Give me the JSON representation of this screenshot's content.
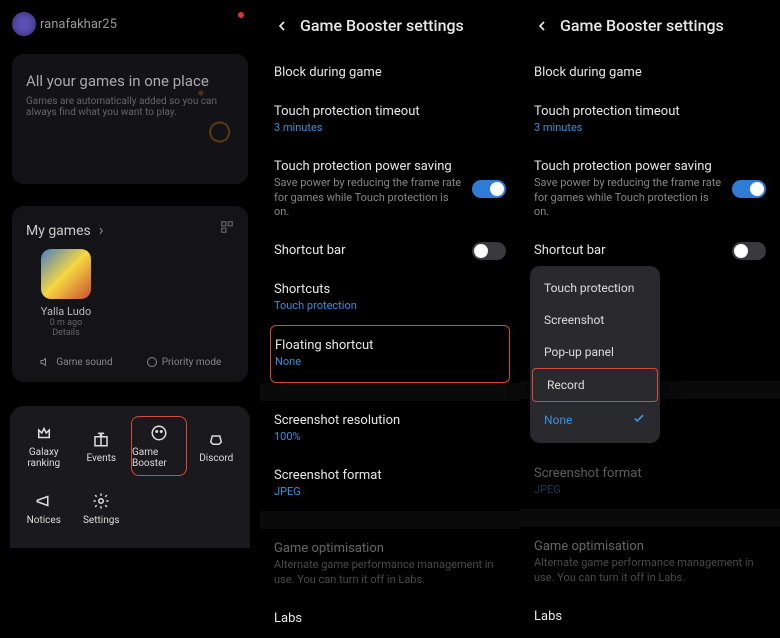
{
  "panel1": {
    "username": "ranafakhar25",
    "hero_title": "All your games in one place",
    "hero_sub": "Games are automatically added so you can always find what you want to play.",
    "my_games_label": "My games",
    "game": {
      "name": "Yalla Ludo",
      "meta1": "0 m ago",
      "meta2": "Details"
    },
    "quick": {
      "sound": "Game sound",
      "priority": "Priority mode"
    },
    "sheet": {
      "galaxy": "Galaxy ranking",
      "events": "Events",
      "booster": "Game Booster",
      "discord": "Discord",
      "notices": "Notices",
      "settings": "Settings"
    }
  },
  "panel2": {
    "title": "Game Booster settings",
    "block": "Block during game",
    "touch_timeout": {
      "title": "Touch protection timeout",
      "sub": "3 minutes"
    },
    "power_saving": {
      "title": "Touch protection power saving",
      "sub": "Save power by reducing the frame rate for games while Touch protection is on."
    },
    "shortcut_bar": "Shortcut bar",
    "shortcuts": {
      "title": "Shortcuts",
      "sub": "Touch protection"
    },
    "floating": {
      "title": "Floating shortcut",
      "sub": "None"
    },
    "ss_res": {
      "title": "Screenshot resolution",
      "sub": "100%"
    },
    "ss_fmt": {
      "title": "Screenshot format",
      "sub": "JPEG"
    },
    "game_opt": {
      "title": "Game optimisation",
      "sub": "Alternate game performance management in use. You can turn it off in Labs."
    },
    "labs": "Labs"
  },
  "panel3": {
    "title": "Game Booster settings",
    "popup": {
      "touch": "Touch protection",
      "screenshot": "Screenshot",
      "popup_panel": "Pop-up panel",
      "record": "Record",
      "none": "None"
    }
  }
}
